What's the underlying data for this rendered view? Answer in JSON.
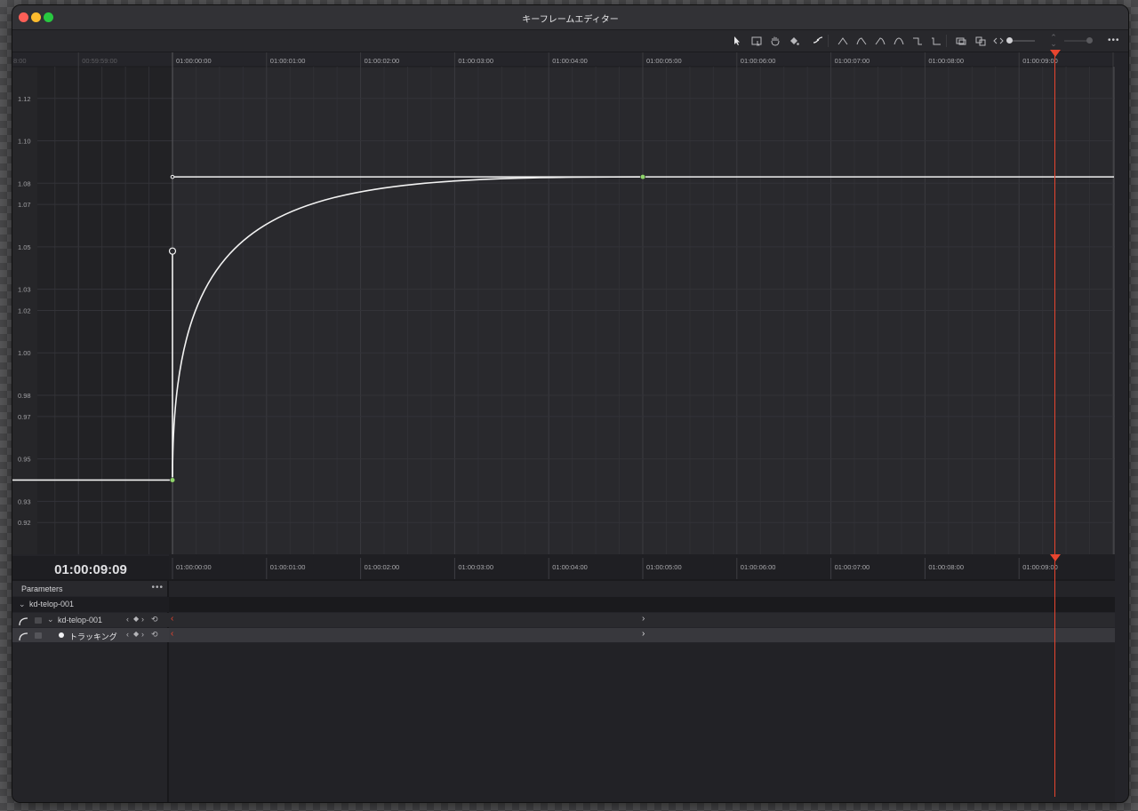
{
  "window": {
    "title": "キーフレームエディター",
    "traffic_colors": {
      "close": "#fe5f57",
      "minimize": "#febc2e",
      "zoom": "#28c840"
    }
  },
  "toolbar": {
    "tools": [
      "pointer-icon",
      "select-region-icon",
      "hand-icon",
      "paint-bucket-icon",
      "curve-fit-icon",
      "linear-ease-icon",
      "ease-in-icon",
      "ease-out-icon",
      "ease-in-out-icon",
      "step-in-icon",
      "step-out-icon",
      "snap-icon",
      "group-icon",
      "zoom-fit-icon"
    ],
    "more_label": "•••"
  },
  "graph": {
    "y_ticks": [
      "1.12",
      "1.10",
      "1.08",
      "1.07",
      "1.05",
      "1.03",
      "1.02",
      "1.00",
      "0.98",
      "0.97",
      "0.95",
      "0.93",
      "0.92"
    ],
    "x_ticks": [
      "8:00",
      "00:59:59:00",
      "01:00:00:00",
      "01:00:01:00",
      "01:00:02:00",
      "01:00:03:00",
      "01:00:04:00",
      "01:00:05:00",
      "01:00:06:00",
      "01:00:07:00",
      "01:00:08:00",
      "01:00:09:00"
    ],
    "curve_color": "#f2f2f2",
    "playhead_color": "#e8452f",
    "keyframe_color": "#8fd46a"
  },
  "chart_data": {
    "type": "line",
    "series": [
      {
        "values": [
          {
            "time": "00:59:58:00",
            "value": 0.94
          },
          {
            "time": "01:00:00:00",
            "value": 0.94
          },
          {
            "time": "01:00:00:00",
            "value": 1.048
          },
          {
            "time": "01:00:05:00",
            "value": 1.083
          },
          {
            "time": "01:00:10:00",
            "value": 1.083
          }
        ]
      }
    ],
    "keyframes": [
      {
        "time": "01:00:00:00",
        "value": 0.94
      },
      {
        "time": "01:00:05:00",
        "value": 1.083
      }
    ],
    "ylim": [
      0.905,
      1.135
    ],
    "playhead": "01:00:09:09"
  },
  "timeline": {
    "timecode": "01:00:09:09",
    "bottom_ticks": [
      "01:00:00:00",
      "01:00:01:00",
      "01:00:02:00",
      "01:00:03:00",
      "01:00:04:00",
      "01:00:05:00",
      "01:00:06:00",
      "01:00:07:00",
      "01:00:08:00",
      "01:00:09:00"
    ]
  },
  "parameters": {
    "header": "Parameters",
    "more": "•••",
    "group": "kd-telop-001",
    "rows": [
      {
        "label": "kd-telop-001"
      },
      {
        "label": "トラッキング"
      }
    ]
  }
}
